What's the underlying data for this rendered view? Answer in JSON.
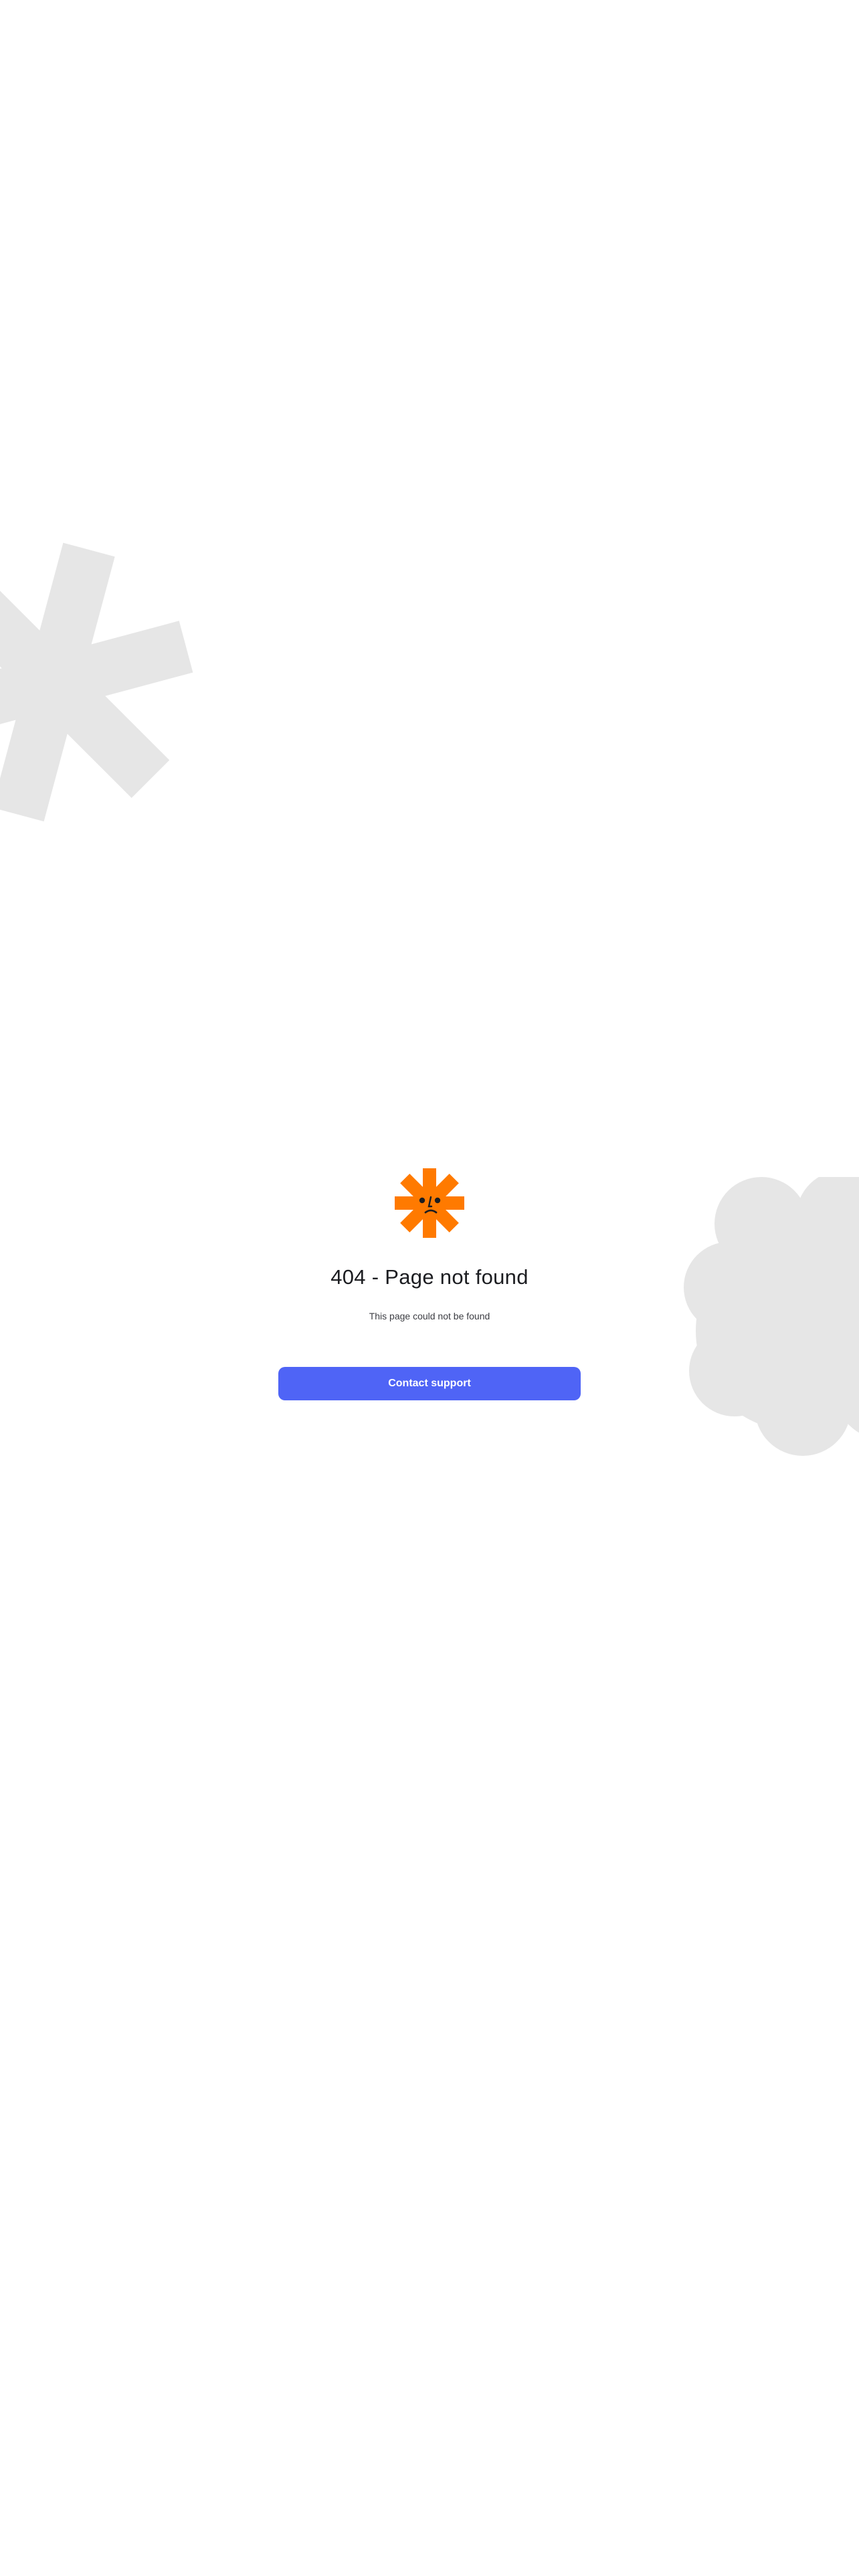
{
  "colors": {
    "background": "#ffffff",
    "shape_gray": "#e6e6e6",
    "logo_orange": "#ff7a00",
    "logo_face": "#1c1d21",
    "title_text": "#1c1d21",
    "subtitle_text": "#3b3c42",
    "button_bg": "#4f64f6",
    "button_text": "#ffffff"
  },
  "icons": {
    "decor_left": "asterisk-icon",
    "decor_right": "cloud-icon",
    "logo": "sad-asterisk-logo-icon"
  },
  "error": {
    "title": "404 - Page not found",
    "message": "This page could not be found"
  },
  "actions": {
    "contact_support_label": "Contact support"
  }
}
